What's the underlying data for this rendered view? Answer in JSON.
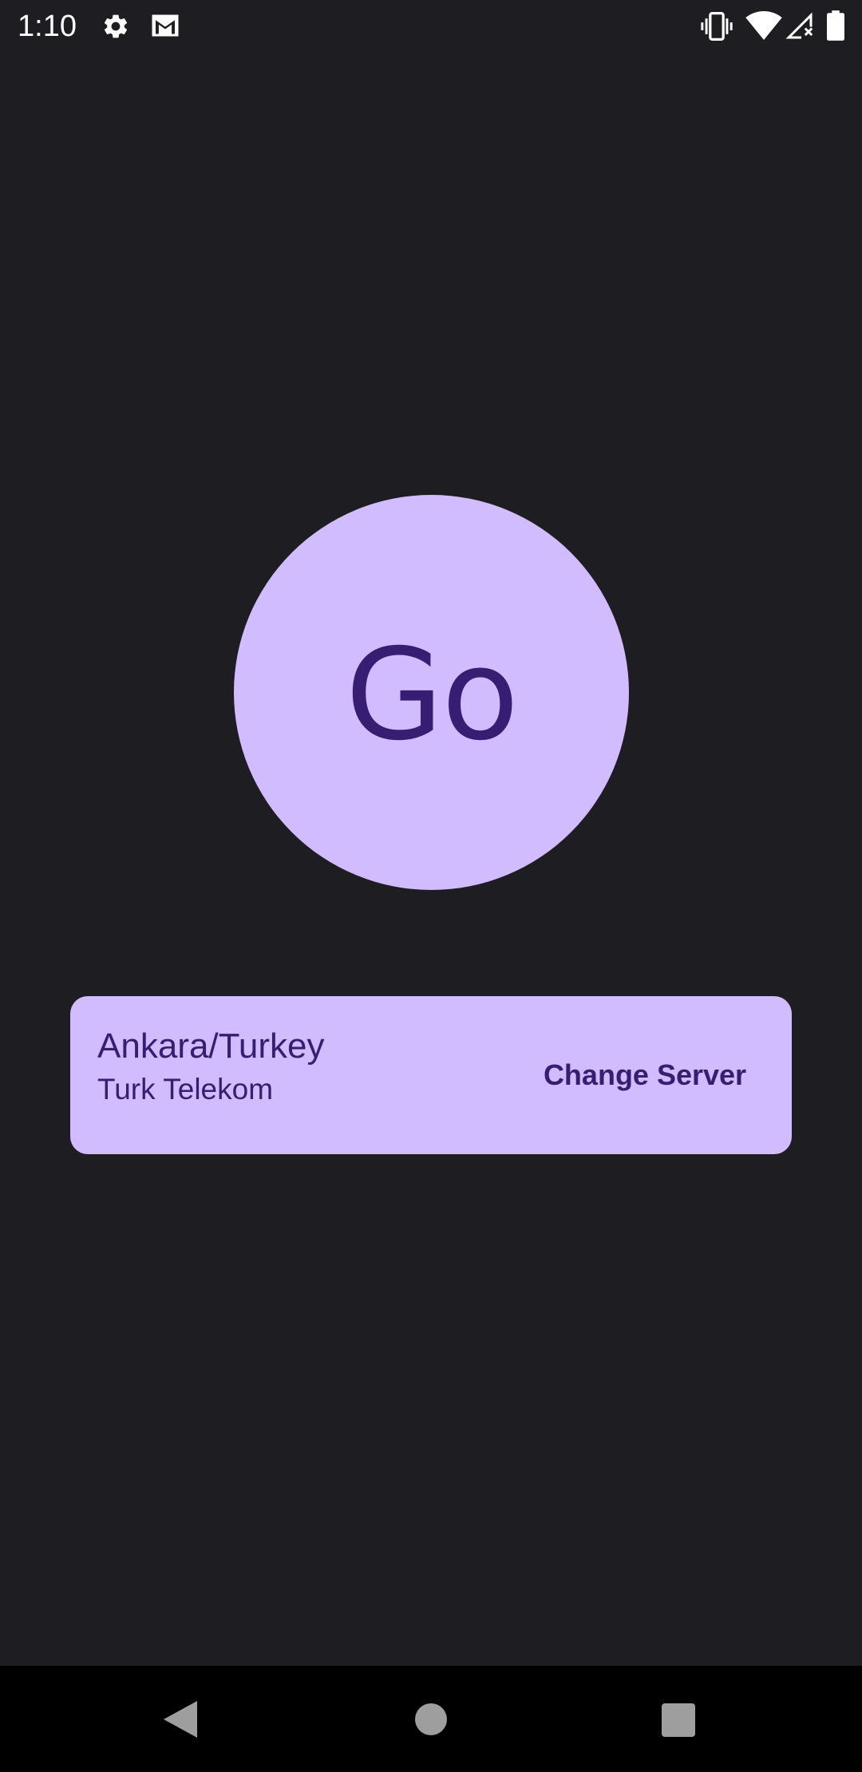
{
  "status_bar": {
    "time": "1:10",
    "left_icons": [
      "gear-icon",
      "gmail-icon"
    ],
    "right_icons": [
      "vibrate-icon",
      "wifi-icon",
      "signal-no-service-icon",
      "battery-icon"
    ]
  },
  "main": {
    "go_button_label": "Go",
    "server": {
      "location": "Ankara/Turkey",
      "provider": "Turk Telekom",
      "change_label": "Change Server"
    }
  },
  "nav_bar": {
    "buttons": [
      "back-icon",
      "home-icon",
      "recents-icon"
    ]
  },
  "colors": {
    "background": "#1e1d22",
    "accent_container": "#d0bcff",
    "on_accent": "#381e72",
    "nav_bar": "#000000",
    "status_icons": "#ffffff",
    "nav_icons": "#9e9e9e"
  }
}
